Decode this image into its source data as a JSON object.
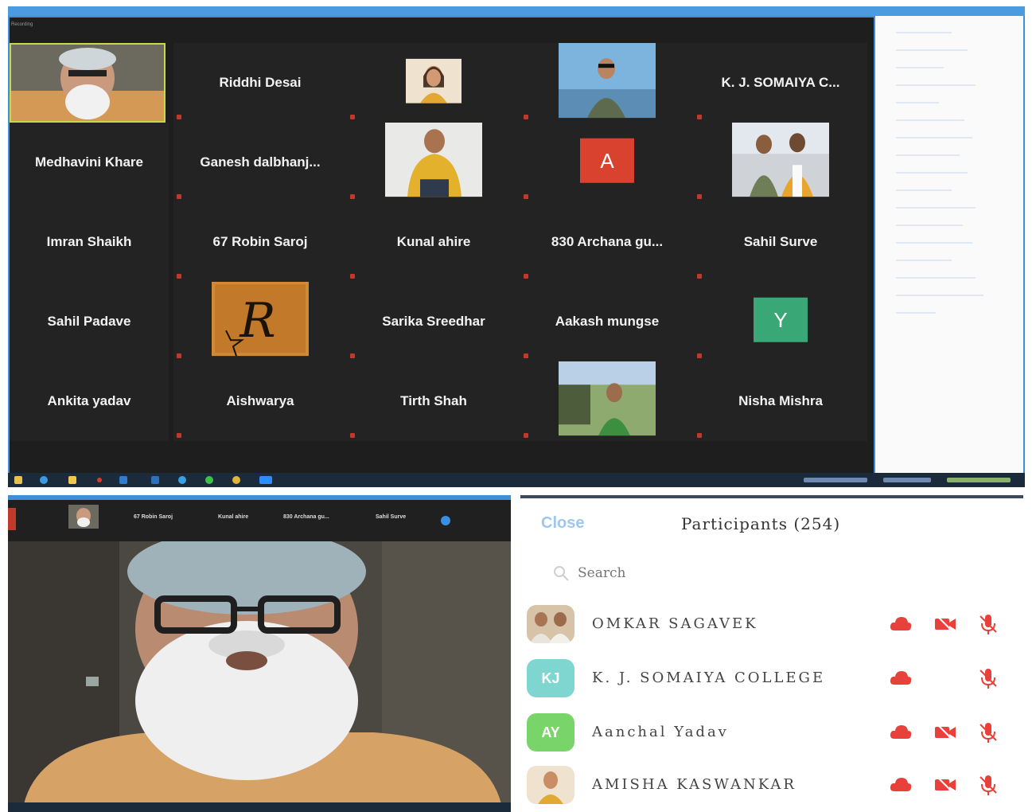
{
  "gallery": {
    "recording_label": "Recording",
    "tiles": [
      {
        "label": "",
        "kind": "photo-host",
        "caption": ""
      },
      {
        "label": "Riddhi Desai",
        "kind": "name"
      },
      {
        "label": "",
        "kind": "photo-woman",
        "caption": ""
      },
      {
        "label": "",
        "kind": "photo-man-sea",
        "caption": ""
      },
      {
        "label": "K. J. SOMAIYA C...",
        "kind": "name"
      },
      {
        "label": "Medhavini Khare",
        "kind": "name"
      },
      {
        "label": "Ganesh dalbhanj...",
        "kind": "name"
      },
      {
        "label": "",
        "kind": "photo-yellow",
        "caption": ""
      },
      {
        "label": "A",
        "kind": "avatar",
        "color": "#d9422f"
      },
      {
        "label": "",
        "kind": "photo-group",
        "caption": ""
      },
      {
        "label": "Imran Shaikh",
        "kind": "name"
      },
      {
        "label": "67 Robin Saroj",
        "kind": "name"
      },
      {
        "label": "Kunal ahire",
        "kind": "name"
      },
      {
        "label": "830 Archana gu...",
        "kind": "name"
      },
      {
        "label": "Sahil Surve",
        "kind": "name"
      },
      {
        "label": "Sahil Padave",
        "kind": "name"
      },
      {
        "label": "",
        "kind": "photo-logo"
      },
      {
        "label": "Sarika Sreedhar",
        "kind": "name"
      },
      {
        "label": "Aakash mungse",
        "kind": "name"
      },
      {
        "label": "Y",
        "kind": "avatar",
        "color": "#3aa876"
      },
      {
        "label": "Ankita yadav",
        "kind": "name"
      },
      {
        "label": "Aishwarya",
        "kind": "name"
      },
      {
        "label": "Tirth Shah",
        "kind": "name"
      },
      {
        "label": "",
        "kind": "photo-outdoor"
      },
      {
        "label": "Nisha Mishra",
        "kind": "name"
      }
    ]
  },
  "bottom_strip": {
    "items": [
      "67 Robin Saroj",
      "Kunal ahire",
      "830 Archana gu...",
      "Sahil Surve"
    ]
  },
  "participants_panel": {
    "close_label": "Close",
    "title": "Participants (254)",
    "search_placeholder": "Search",
    "rows": [
      {
        "name": "OMKAR SAGAVEK",
        "avatar_kind": "photo",
        "avatar_text": "",
        "icons": [
          "cloud-icon",
          "video-off-icon",
          "mic-off-icon"
        ]
      },
      {
        "name": "K. J. SOMAIYA COLLEGE",
        "avatar_kind": "initials",
        "avatar_text": "KJ",
        "avatar_color": "#7fd6d0",
        "icons": [
          "cloud-icon",
          "mic-off-icon"
        ]
      },
      {
        "name": "Aanchal Yadav",
        "avatar_kind": "initials",
        "avatar_text": "AY",
        "avatar_color": "#79d46a",
        "icons": [
          "cloud-icon",
          "video-off-icon",
          "mic-off-icon"
        ]
      },
      {
        "name": "AMISHA KASWANKAR",
        "avatar_kind": "photo",
        "avatar_text": "",
        "icons": [
          "cloud-icon",
          "video-off-icon",
          "mic-off-icon"
        ]
      }
    ]
  },
  "colors": {
    "accent_red": "#e8413b",
    "close_blue": "#9ec7f0",
    "gallery_bg": "#1e1e1e"
  }
}
